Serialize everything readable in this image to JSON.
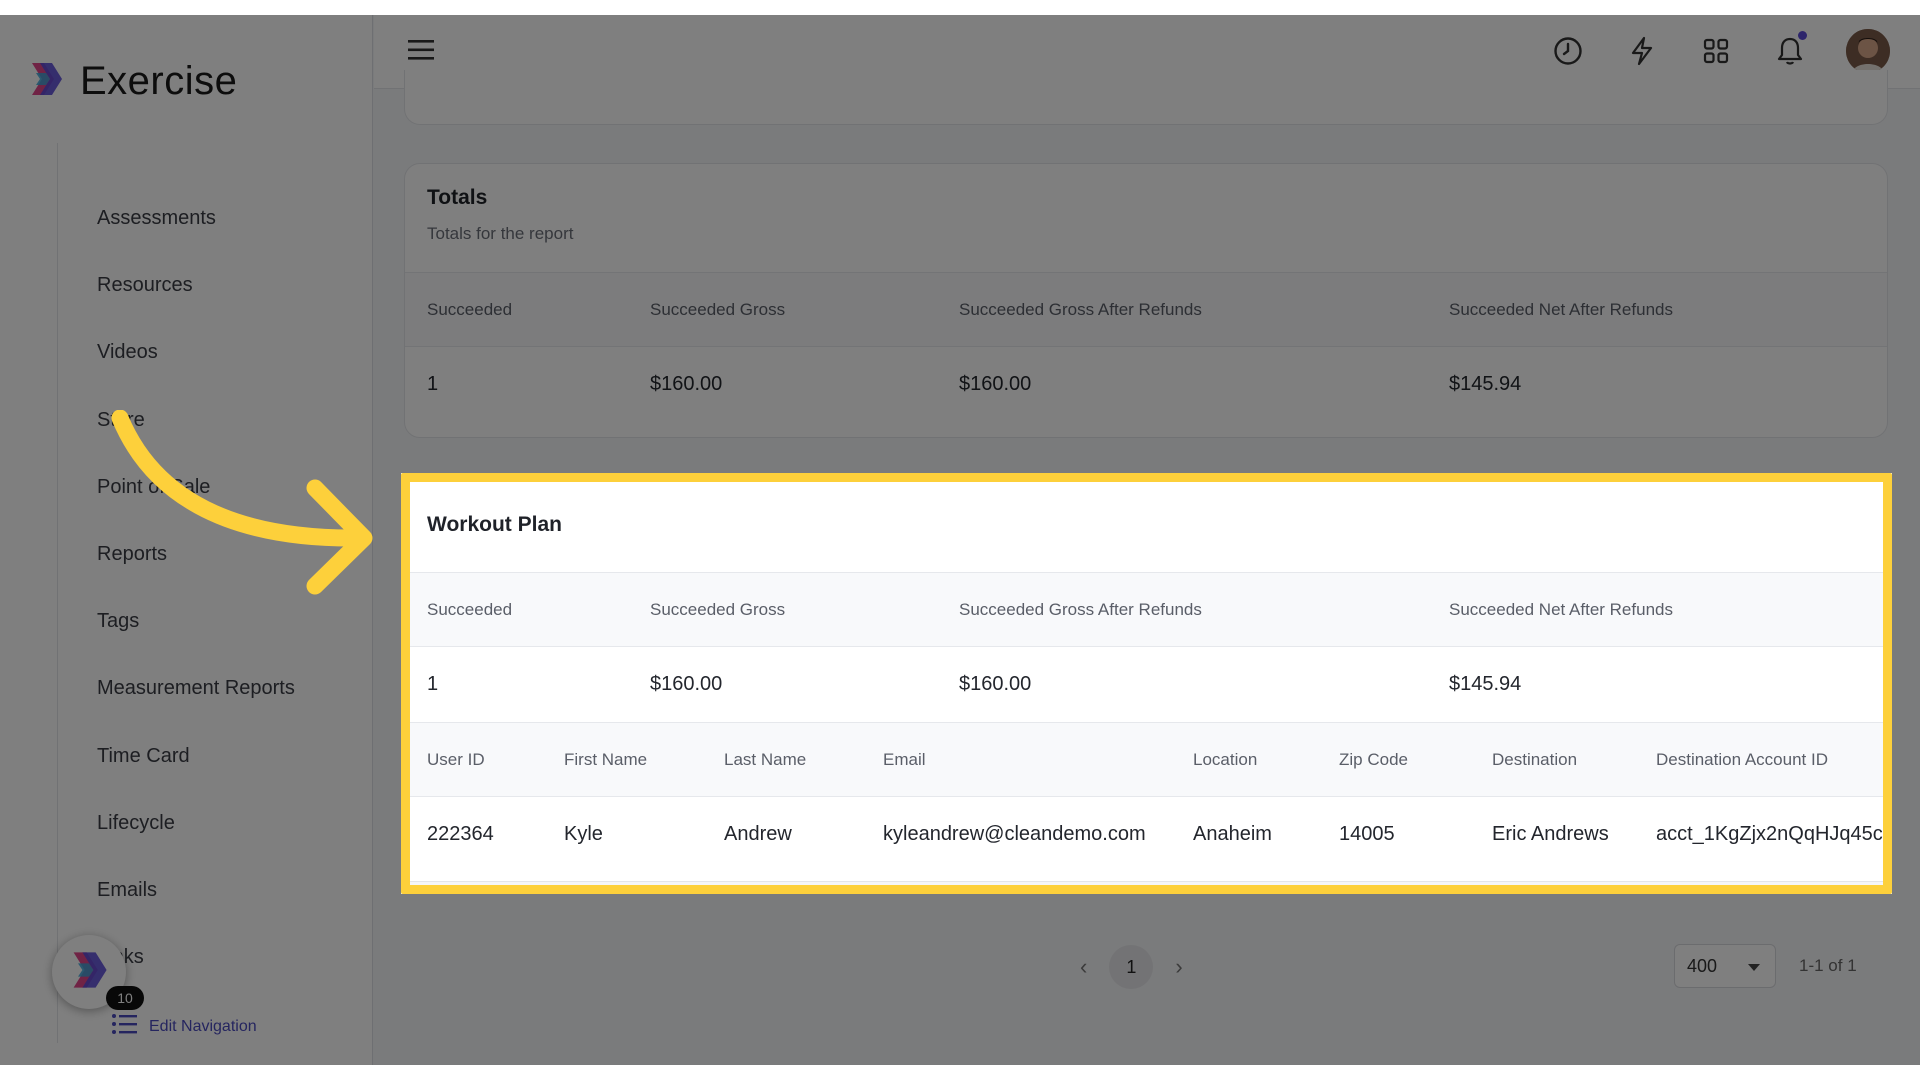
{
  "app": {
    "title": "Exercise"
  },
  "sidebar": {
    "items": [
      {
        "label": "Assessments"
      },
      {
        "label": "Resources"
      },
      {
        "label": "Videos"
      },
      {
        "label": "Store"
      },
      {
        "label": "Point of Sale"
      },
      {
        "label": "Reports"
      },
      {
        "label": "Tags"
      },
      {
        "label": "Measurement Reports"
      },
      {
        "label": "Time Card"
      },
      {
        "label": "Lifecycle"
      },
      {
        "label": "Emails"
      },
      {
        "label": "Links"
      }
    ],
    "badge_count": "10",
    "edit_navigation": "Edit Navigation"
  },
  "topbar": {
    "icons": [
      "menu-icon",
      "clock-icon",
      "bolt-icon",
      "apps-grid-icon",
      "bell-icon",
      "user-avatar"
    ],
    "notification_dot_color": "#5b4bd6"
  },
  "totals": {
    "title": "Totals",
    "subtitle": "Totals for the report",
    "columns": [
      "Succeeded",
      "Succeeded Gross",
      "Succeeded Gross After Refunds",
      "Succeeded Net After Refunds"
    ],
    "values": [
      "1",
      "$160.00",
      "$160.00",
      "$145.94"
    ]
  },
  "workout": {
    "title": "Workout Plan",
    "summary_columns": [
      "Succeeded",
      "Succeeded Gross",
      "Succeeded Gross After Refunds",
      "Succeeded Net After Refunds"
    ],
    "summary_values": [
      "1",
      "$160.00",
      "$160.00",
      "$145.94"
    ],
    "detail_columns": [
      "User ID",
      "First Name",
      "Last Name",
      "Email",
      "Location",
      "Zip Code",
      "Destination",
      "Destination Account ID"
    ],
    "detail_values": [
      "222364",
      "Kyle",
      "Andrew",
      "kyleandrew@cleandemo.com",
      "Anaheim",
      "14005",
      "Eric Andrews",
      "acct_1KgZjx2nQqHJq45c"
    ]
  },
  "pagination": {
    "prev": "‹",
    "current_page": "1",
    "next": "›",
    "per_page": "400",
    "range": "1-1 of 1"
  },
  "colors": {
    "highlight": "#fdd03b",
    "accent": "#4b4bbf"
  }
}
